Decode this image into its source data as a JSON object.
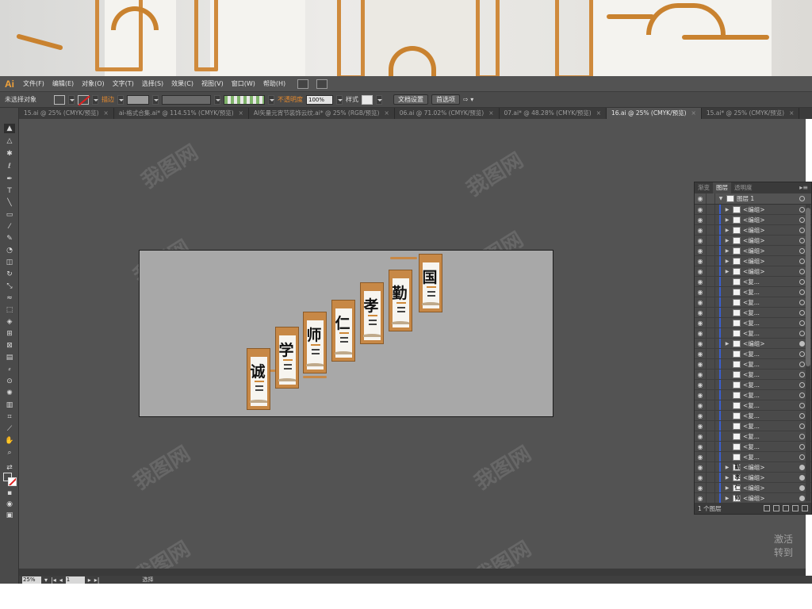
{
  "app": {
    "logo": "Ai"
  },
  "menu": [
    "文件(F)",
    "编辑(E)",
    "对象(O)",
    "文字(T)",
    "选择(S)",
    "效果(C)",
    "视图(V)",
    "窗口(W)",
    "帮助(H)"
  ],
  "control": {
    "selection": "未选择对象",
    "stroke_label": "描边",
    "opacity_label": "不透明度",
    "opacity_value": "100%",
    "style_label": "样式",
    "doc_setup": "文档设置",
    "preferences": "首选项"
  },
  "tabs": [
    {
      "label": "15.ai @ 25% (CMYK/预览)",
      "active": false
    },
    {
      "label": "ai-格式合集.ai* @ 114.51% (CMYK/预览)",
      "active": false
    },
    {
      "label": "AI矢量元宵节装饰云纹.ai* @ 25% (RGB/预览)",
      "active": false
    },
    {
      "label": "06.ai @ 71.02% (CMYK/预览)",
      "active": false
    },
    {
      "label": "07.ai* @ 48.28% (CMYK/预览)",
      "active": false
    },
    {
      "label": "16.ai @ 25% (CMYK/预览)",
      "active": true
    },
    {
      "label": "15.ai* @ 25% (CMYK/预览)",
      "active": false
    }
  ],
  "artwork": {
    "characters": [
      "诚",
      "学",
      "师",
      "仁",
      "孝",
      "勤",
      "国"
    ]
  },
  "layers_panel": {
    "tabs": [
      "渐变",
      "图层",
      "透明度"
    ],
    "active_tab": "图层",
    "top_layer": "图层 1",
    "rows": [
      {
        "name": "<编组>",
        "thumb": "",
        "expand": true,
        "filled": false
      },
      {
        "name": "<编组>",
        "thumb": "",
        "expand": true,
        "filled": false
      },
      {
        "name": "<编组>",
        "thumb": "",
        "expand": true,
        "filled": false
      },
      {
        "name": "<编组>",
        "thumb": "",
        "expand": true,
        "filled": false
      },
      {
        "name": "<编组>",
        "thumb": "",
        "expand": true,
        "filled": false
      },
      {
        "name": "<编组>",
        "thumb": "",
        "expand": true,
        "filled": false
      },
      {
        "name": "<编组>",
        "thumb": "",
        "expand": true,
        "filled": false
      },
      {
        "name": "<复...",
        "thumb": "",
        "expand": false,
        "filled": false
      },
      {
        "name": "<复...",
        "thumb": "",
        "expand": false,
        "filled": false
      },
      {
        "name": "<复...",
        "thumb": "",
        "expand": false,
        "filled": false
      },
      {
        "name": "<复...",
        "thumb": "",
        "expand": false,
        "filled": false
      },
      {
        "name": "<复...",
        "thumb": "",
        "expand": false,
        "filled": false
      },
      {
        "name": "<复...",
        "thumb": "",
        "expand": false,
        "filled": false
      },
      {
        "name": "<编组>",
        "thumb": "",
        "expand": true,
        "filled": true
      },
      {
        "name": "<复...",
        "thumb": "",
        "expand": false,
        "filled": false
      },
      {
        "name": "<复...",
        "thumb": "",
        "expand": false,
        "filled": false
      },
      {
        "name": "<复...",
        "thumb": "",
        "expand": false,
        "filled": false
      },
      {
        "name": "<复...",
        "thumb": "",
        "expand": false,
        "filled": false
      },
      {
        "name": "<复...",
        "thumb": "",
        "expand": false,
        "filled": false
      },
      {
        "name": "<复...",
        "thumb": "",
        "expand": false,
        "filled": false
      },
      {
        "name": "<复...",
        "thumb": "",
        "expand": false,
        "filled": false
      },
      {
        "name": "<复...",
        "thumb": "",
        "expand": false,
        "filled": false
      },
      {
        "name": "<复...",
        "thumb": "",
        "expand": false,
        "filled": false
      },
      {
        "name": "<复...",
        "thumb": "",
        "expand": false,
        "filled": false
      },
      {
        "name": "<复...",
        "thumb": "",
        "expand": false,
        "filled": false
      },
      {
        "name": "<编组>",
        "thumb": "勤",
        "expand": true,
        "filled": true
      },
      {
        "name": "<编组>",
        "thumb": "孝",
        "expand": true,
        "filled": true
      },
      {
        "name": "<编组>",
        "thumb": "仁",
        "expand": true,
        "filled": true
      },
      {
        "name": "<编组>",
        "thumb": "师",
        "expand": true,
        "filled": true
      },
      {
        "name": "<编组>",
        "thumb": "学",
        "expand": true,
        "filled": true
      }
    ],
    "footer": "1 个图层"
  },
  "status": {
    "zoom": "25%",
    "page": "1",
    "tool": "选择"
  },
  "watermark": "我图网",
  "activation_text": [
    "激活",
    "转到"
  ],
  "colors": {
    "accent": "#e68a2e",
    "frame": "#c78846",
    "ui_bg": "#535353",
    "selection_blue": "#3a5fd0"
  }
}
